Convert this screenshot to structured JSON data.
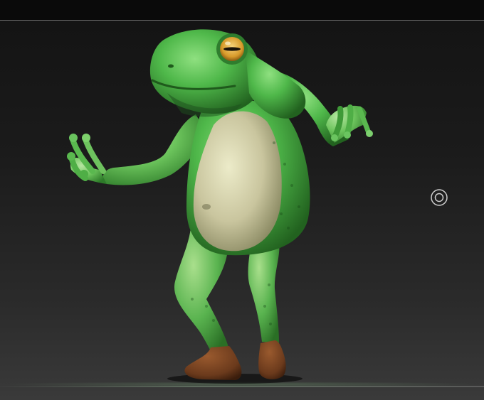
{
  "viewport": {
    "background_top": "#141414",
    "background_bottom": "#3a3a3a",
    "border_color": "#6a6a6a"
  },
  "model": {
    "subject": "frog-character",
    "skin_color": "#4fb84a",
    "skin_dark": "#2f7d2e",
    "belly_color": "#c9c59e",
    "eye_color": "#d79a2a",
    "shoe_color": "#6b3a1c"
  },
  "gizmo": {
    "icon": "rotation-target-icon",
    "color": "#cfcfcf"
  }
}
